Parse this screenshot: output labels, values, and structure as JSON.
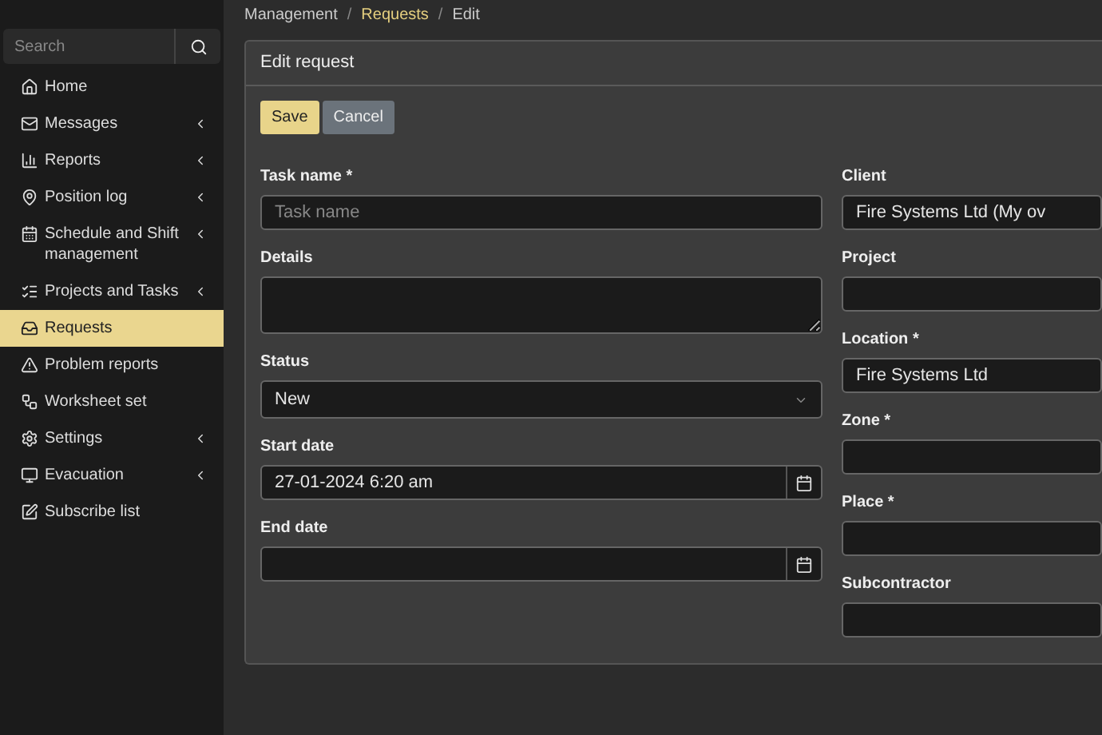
{
  "sidebar": {
    "search": {
      "placeholder": "Search"
    },
    "items": [
      {
        "label": "Home",
        "expandable": false,
        "selected": false
      },
      {
        "label": "Messages",
        "expandable": true,
        "selected": false
      },
      {
        "label": "Reports",
        "expandable": true,
        "selected": false
      },
      {
        "label": "Position log",
        "expandable": true,
        "selected": false
      },
      {
        "label": "Schedule and Shift management",
        "expandable": true,
        "selected": false
      },
      {
        "label": "Projects and Tasks",
        "expandable": true,
        "selected": false
      },
      {
        "label": "Requests",
        "expandable": false,
        "selected": true
      },
      {
        "label": "Problem reports",
        "expandable": false,
        "selected": false
      },
      {
        "label": "Worksheet set",
        "expandable": false,
        "selected": false
      },
      {
        "label": "Settings",
        "expandable": true,
        "selected": false
      },
      {
        "label": "Evacuation",
        "expandable": true,
        "selected": false
      },
      {
        "label": "Subscribe list",
        "expandable": false,
        "selected": false
      }
    ]
  },
  "breadcrumb": {
    "items": [
      {
        "label": "Management",
        "selected": false
      },
      {
        "label": "Requests",
        "selected": true
      },
      {
        "label": "Edit",
        "selected": false
      }
    ],
    "separators": [
      "/",
      "/"
    ]
  },
  "card": {
    "title": "Edit request",
    "buttons": [
      {
        "label": "Save",
        "kind": "primary"
      },
      {
        "label": "Cancel",
        "kind": "secondary"
      }
    ],
    "left_fields": [
      {
        "label": "Task name *",
        "kind": "text",
        "placeholder": "Task name"
      },
      {
        "label": "Details",
        "kind": "textarea"
      },
      {
        "label": "Status",
        "kind": "select",
        "value": "New"
      },
      {
        "label": "Start date",
        "kind": "date",
        "value": "27-01-2024 6:20 am"
      },
      {
        "label": "End date",
        "kind": "date"
      }
    ],
    "right_fields": [
      {
        "label": "Client",
        "kind": "text",
        "value": "Fire Systems Ltd (My ov"
      },
      {
        "label": "Project",
        "kind": "text"
      },
      {
        "label": "Location *",
        "kind": "text",
        "value": "Fire Systems Ltd"
      },
      {
        "label": "Zone *",
        "kind": "text"
      },
      {
        "label": "Place *",
        "kind": "text"
      },
      {
        "label": "Subcontractor",
        "kind": "text"
      }
    ]
  }
}
